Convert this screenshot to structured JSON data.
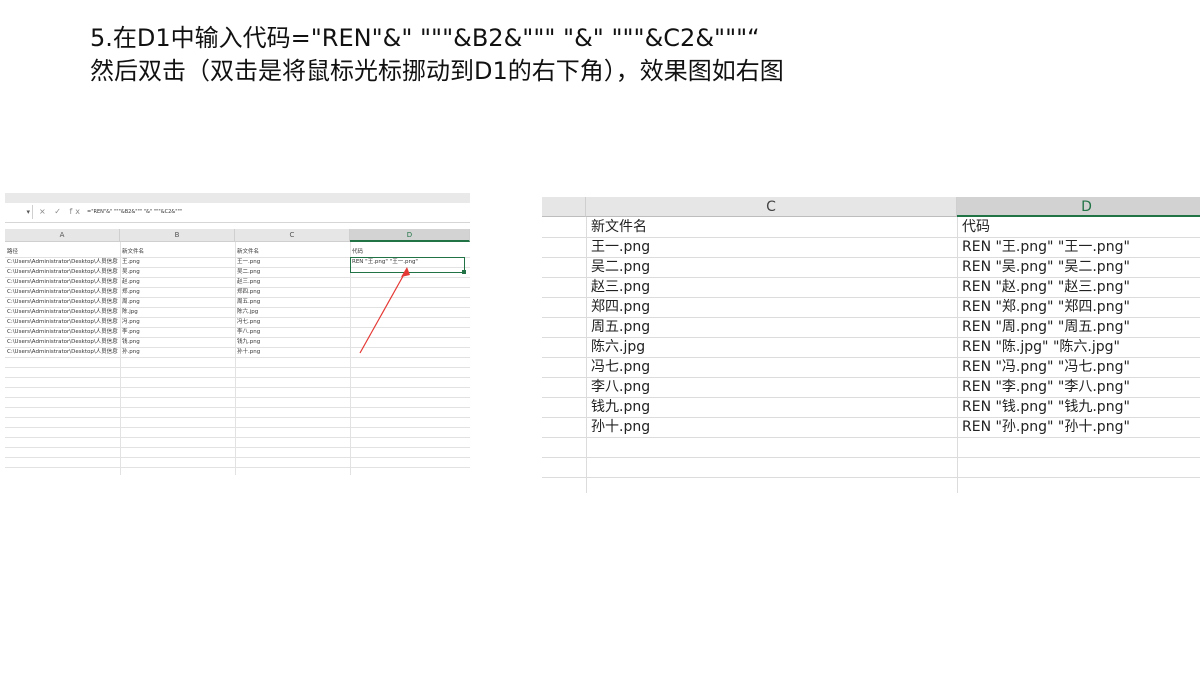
{
  "heading": {
    "line1": "5.在D1中输入代码=\"REN\"&\" \"\"\"&B2&\"\"\" \"&\" \"\"\"&C2&\"\"\"“",
    "line2": "然后双击（双击是将鼠标光标挪动到D1的右下角），效果图如右图"
  },
  "left_sheet": {
    "formula_bar": {
      "namebox": "▾",
      "icons": "× ✓ fx",
      "formula": "=\"REN\"&\" \"\"\"&B2&\"\"\" \"&\" \"\"\"&C2&\"\"\""
    },
    "columns": [
      "A",
      "B",
      "C",
      "D"
    ],
    "headers": [
      "路径",
      "新文件名",
      "新文件名",
      "代码"
    ],
    "rows": [
      [
        "C:\\Users\\Administrator\\Desktop\\人员信息\\王.png",
        "王.png",
        "王一.png",
        "REN \"王.png\" \"王一.png\""
      ],
      [
        "C:\\Users\\Administrator\\Desktop\\人员信息\\吴.png",
        "吴.png",
        "吴二.png",
        ""
      ],
      [
        "C:\\Users\\Administrator\\Desktop\\人员信息\\赵.png",
        "赵.png",
        "赵三.png",
        ""
      ],
      [
        "C:\\Users\\Administrator\\Desktop\\人员信息\\郑.png",
        "郑.png",
        "郑四.png",
        ""
      ],
      [
        "C:\\Users\\Administrator\\Desktop\\人员信息\\周.png",
        "周.png",
        "周五.png",
        ""
      ],
      [
        "C:\\Users\\Administrator\\Desktop\\人员信息\\陈.jpg",
        "陈.jpg",
        "陈六.jpg",
        ""
      ],
      [
        "C:\\Users\\Administrator\\Desktop\\人员信息\\冯.png",
        "冯.png",
        "冯七.png",
        ""
      ],
      [
        "C:\\Users\\Administrator\\Desktop\\人员信息\\李.png",
        "李.png",
        "李八.png",
        ""
      ],
      [
        "C:\\Users\\Administrator\\Desktop\\人员信息\\钱.png",
        "钱.png",
        "钱九.png",
        ""
      ],
      [
        "C:\\Users\\Administrator\\Desktop\\人员信息\\孙.png",
        "孙.png",
        "孙十.png",
        ""
      ]
    ],
    "annotation_color": "#e53935",
    "selection_color": "#217346"
  },
  "right_sheet": {
    "columns": [
      "C",
      "D"
    ],
    "headers": [
      "新文件名",
      "代码"
    ],
    "rows": [
      [
        "王一.png",
        "REN \"王.png\"  \"王一.png\""
      ],
      [
        "吴二.png",
        "REN \"吴.png\"  \"吴二.png\""
      ],
      [
        "赵三.png",
        "REN \"赵.png\"  \"赵三.png\""
      ],
      [
        "郑四.png",
        "REN \"郑.png\"  \"郑四.png\""
      ],
      [
        "周五.png",
        "REN \"周.png\"  \"周五.png\""
      ],
      [
        "陈六.jpg",
        "REN \"陈.jpg\"  \"陈六.jpg\""
      ],
      [
        "冯七.png",
        "REN \"冯.png\"  \"冯七.png\""
      ],
      [
        "李八.png",
        "REN \"李.png\"  \"李八.png\""
      ],
      [
        "钱九.png",
        "REN \"钱.png\"  \"钱九.png\""
      ],
      [
        "孙十.png",
        "REN \"孙.png\"  \"孙十.png\""
      ]
    ]
  }
}
